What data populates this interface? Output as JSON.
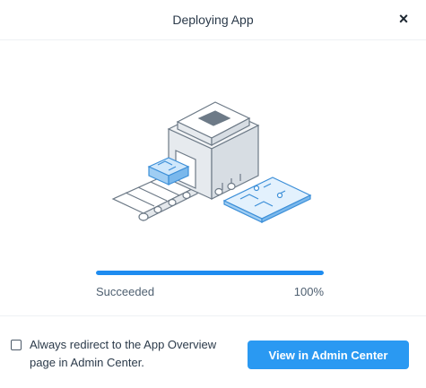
{
  "dialog": {
    "title": "Deploying App",
    "close_icon": "×"
  },
  "illustration": {
    "icon": "app-deploy-conveyor-illustration"
  },
  "progress": {
    "status": "Succeeded",
    "percent_label": "100%",
    "percent": 100
  },
  "footer": {
    "checkbox_label": "Always redirect to the App Overview page in Admin Center.",
    "checkbox_checked": false,
    "primary_button_label": "View in Admin Center"
  },
  "colors": {
    "accent": "#2a99f2",
    "progress_fill": "#1e8cf0",
    "illustration_blue": "#5fb3ee"
  }
}
